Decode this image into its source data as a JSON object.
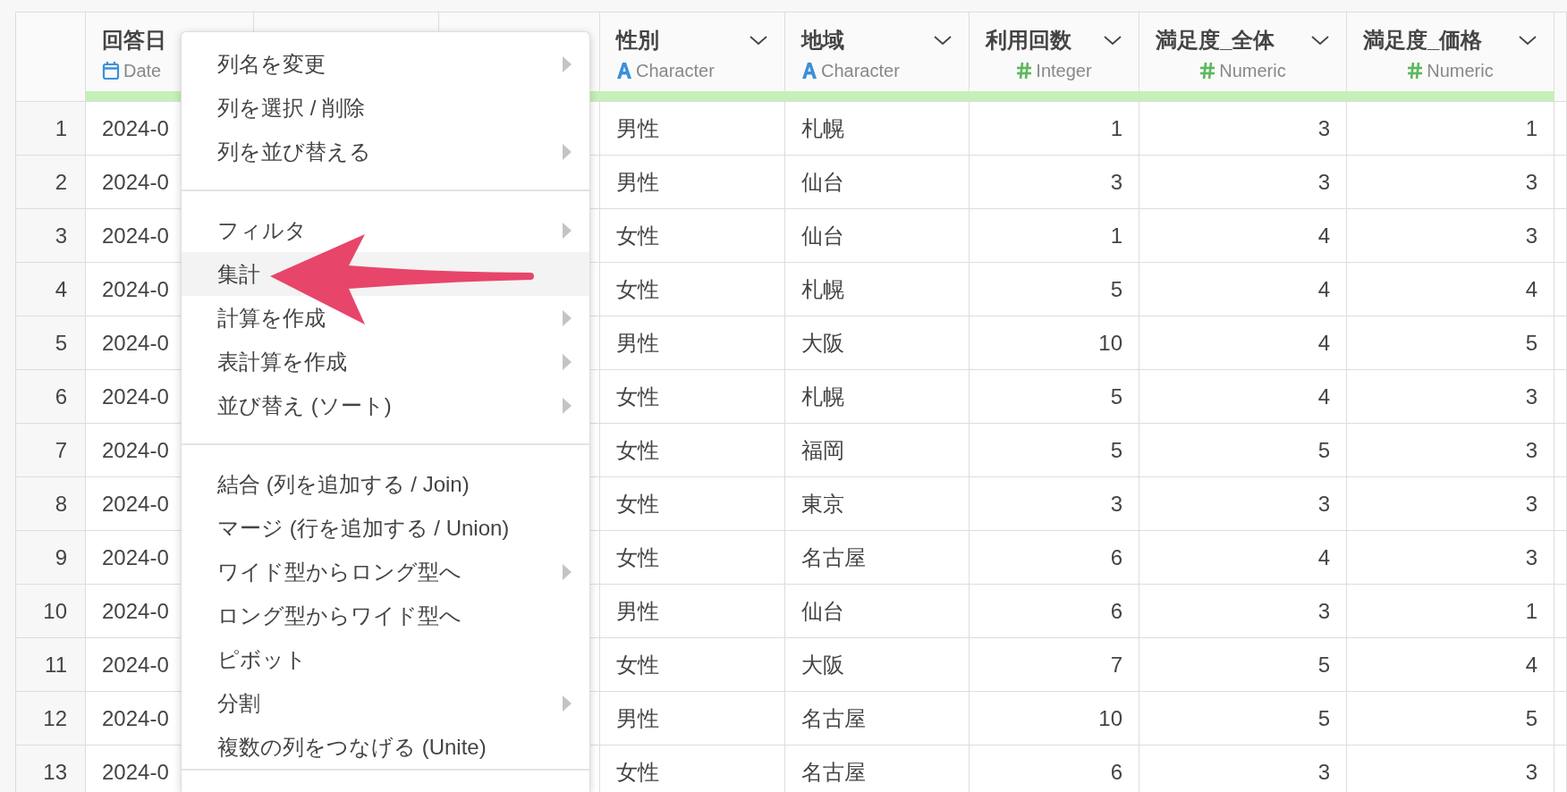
{
  "table": {
    "columns": [
      {
        "name": "回答日",
        "type": "Date",
        "kind": "date"
      },
      {
        "name": "性別",
        "type": "Character",
        "kind": "character",
        "has_menu": true
      },
      {
        "name": "地域",
        "type": "Character",
        "kind": "character",
        "has_menu": true
      },
      {
        "name": "利用回数",
        "type": "Integer",
        "kind": "number",
        "has_menu": true
      },
      {
        "name": "満足度_全体",
        "type": "Numeric",
        "kind": "number",
        "has_menu": true
      },
      {
        "name": "満足度_価格",
        "type": "Numeric",
        "kind": "number",
        "has_menu": true
      }
    ],
    "rows": [
      {
        "num": "1",
        "cells": [
          "2024-0",
          "男性",
          "札幌",
          "1",
          "3",
          "1"
        ]
      },
      {
        "num": "2",
        "cells": [
          "2024-0",
          "男性",
          "仙台",
          "3",
          "3",
          "3"
        ]
      },
      {
        "num": "3",
        "cells": [
          "2024-0",
          "女性",
          "仙台",
          "1",
          "4",
          "3"
        ]
      },
      {
        "num": "4",
        "cells": [
          "2024-0",
          "女性",
          "札幌",
          "5",
          "4",
          "4"
        ]
      },
      {
        "num": "5",
        "cells": [
          "2024-0",
          "男性",
          "大阪",
          "10",
          "4",
          "5"
        ]
      },
      {
        "num": "6",
        "cells": [
          "2024-0",
          "女性",
          "札幌",
          "5",
          "4",
          "3"
        ]
      },
      {
        "num": "7",
        "cells": [
          "2024-0",
          "女性",
          "福岡",
          "5",
          "5",
          "3"
        ]
      },
      {
        "num": "8",
        "cells": [
          "2024-0",
          "女性",
          "東京",
          "3",
          "3",
          "3"
        ]
      },
      {
        "num": "9",
        "cells": [
          "2024-0",
          "女性",
          "名古屋",
          "6",
          "4",
          "3"
        ]
      },
      {
        "num": "10",
        "cells": [
          "2024-0",
          "男性",
          "仙台",
          "6",
          "3",
          "1"
        ]
      },
      {
        "num": "11",
        "cells": [
          "2024-0",
          "女性",
          "大阪",
          "7",
          "5",
          "4"
        ]
      },
      {
        "num": "12",
        "cells": [
          "2024-0",
          "男性",
          "名古屋",
          "10",
          "5",
          "5"
        ]
      },
      {
        "num": "13",
        "cells": [
          "2024-0",
          "女性",
          "名古屋",
          "6",
          "3",
          "3"
        ]
      }
    ]
  },
  "context_menu": {
    "groups": [
      [
        {
          "label": "列名を変更",
          "submenu": true,
          "selected": false
        },
        {
          "label": "列を選択 / 削除",
          "submenu": false,
          "selected": false
        },
        {
          "label": "列を並び替える",
          "submenu": true,
          "selected": false
        }
      ],
      [
        {
          "label": "フィルタ",
          "submenu": true,
          "selected": false
        },
        {
          "label": "集計",
          "submenu": false,
          "selected": true
        },
        {
          "label": "計算を作成",
          "submenu": true,
          "selected": false
        },
        {
          "label": "表計算を作成",
          "submenu": true,
          "selected": false
        },
        {
          "label": "並び替え (ソート)",
          "submenu": true,
          "selected": false
        }
      ],
      [
        {
          "label": "結合 (列を追加する / Join)",
          "submenu": false,
          "selected": false
        },
        {
          "label": "マージ (行を追加する / Union)",
          "submenu": false,
          "selected": false
        },
        {
          "label": "ワイド型からロング型へ",
          "submenu": true,
          "selected": false
        },
        {
          "label": "ロング型からワイド型へ",
          "submenu": false,
          "selected": false
        },
        {
          "label": "ピボット",
          "submenu": false,
          "selected": false
        },
        {
          "label": "分割",
          "submenu": true,
          "selected": false
        },
        {
          "label": "複数の列をつなげる (Unite)",
          "submenu": false,
          "selected": false
        }
      ]
    ]
  }
}
